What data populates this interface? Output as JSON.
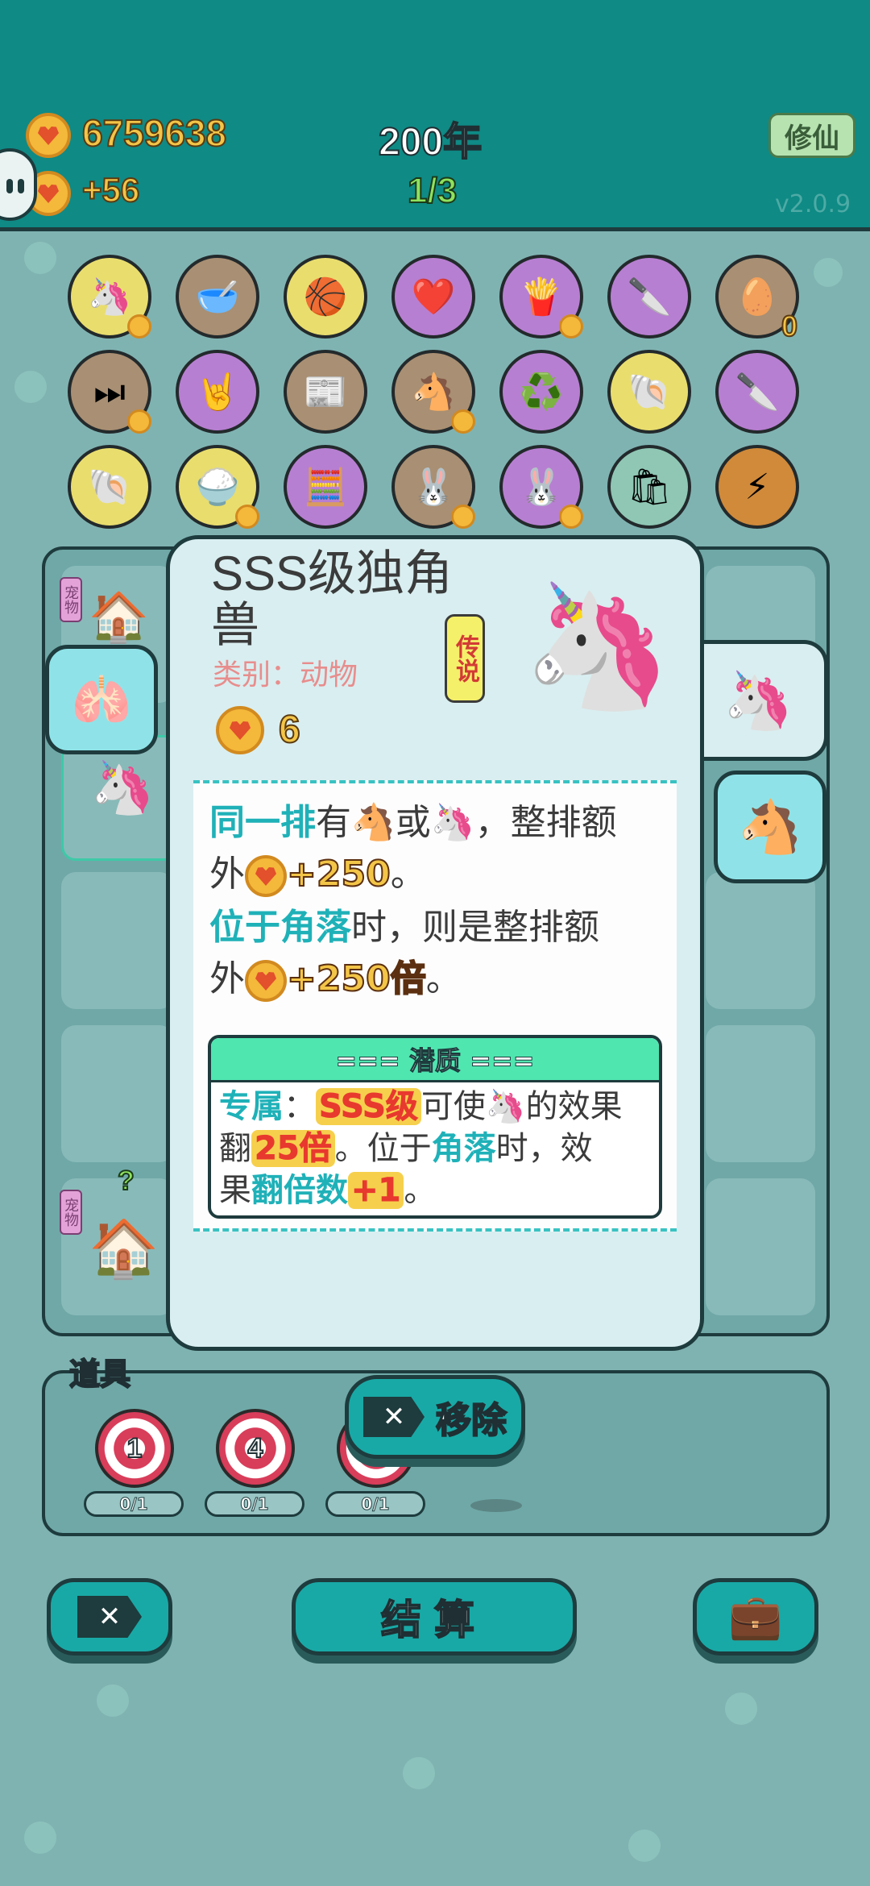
{
  "header": {
    "coins": "6759638",
    "income": "+56",
    "year": "200年",
    "round": "1/3",
    "mode_button": "修仙",
    "version": "v2.0.9"
  },
  "card": {
    "title": "SSS级独角兽",
    "category": "类别：动物",
    "rarity": "传说",
    "value": "6",
    "desc_line1_kw": "同一排",
    "desc_line1_a": "有",
    "desc_line1_b": "或",
    "desc_line1_c": "，整排额",
    "desc_line2_a": "外",
    "desc_line2_num": "+250",
    "desc_line2_b": "。",
    "desc_line3_kw": "位于角落",
    "desc_line3_a": "时，则是整排额",
    "desc_line4_a": "外",
    "desc_line4_num": "+250倍",
    "desc_line4_b": "。",
    "potential_title": "=== 潜质 ===",
    "pot_kw1": "专属",
    "pot_a": "：",
    "pot_num1": "SSS级",
    "pot_b": "可使",
    "pot_c": "的效果",
    "pot_d": "翻",
    "pot_num2": "25倍",
    "pot_e": "。位于",
    "pot_kw2": "角落",
    "pot_f": "时，效",
    "pot_g": "果",
    "pot_kw3": "翻倍数",
    "pot_num3": "+1",
    "pot_h": "。"
  },
  "board": {
    "slot_label": "宠物",
    "question": "?"
  },
  "items": {
    "title": "道具",
    "targets": [
      {
        "num": "1",
        "count": "0/1"
      },
      {
        "num": "4",
        "count": "0/1"
      },
      {
        "num": "",
        "count": "0/1"
      }
    ]
  },
  "remove_button": "移除",
  "settle_button": "结算",
  "symbol_badge_count": "0",
  "colors": {
    "teal": "#0f8a85",
    "dark": "#1e3b3d",
    "purple": "#b77fd1",
    "yellow": "#e9dd6e",
    "brown": "#a98f73"
  }
}
